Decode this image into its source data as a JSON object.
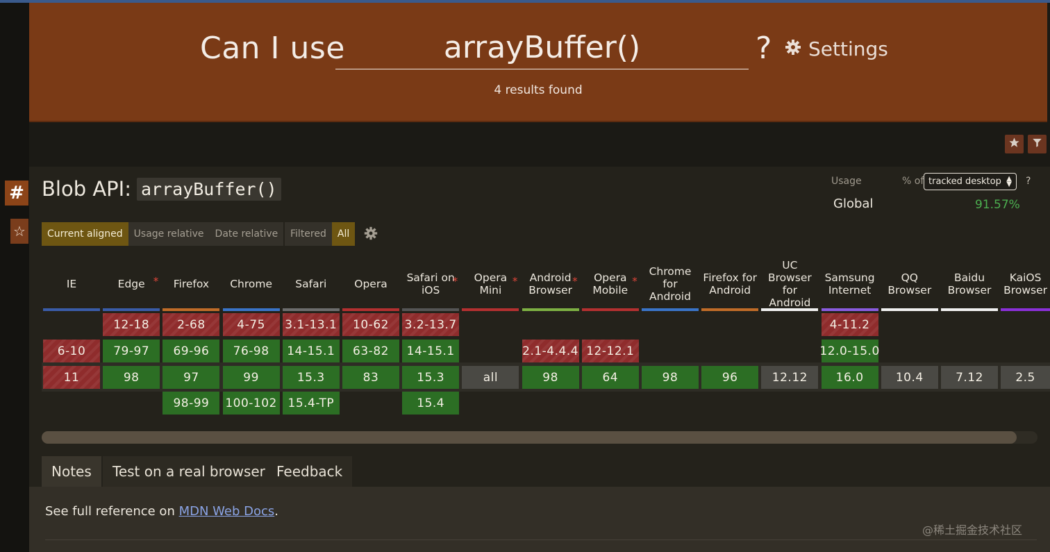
{
  "header": {
    "prefix": "Can I use",
    "search_value": "arrayBuffer()",
    "qmark": "?",
    "settings_label": "Settings",
    "results": "4 results found"
  },
  "feature": {
    "title": "Blob API:",
    "code": "arrayBuffer()",
    "usage_label": "Usage",
    "pct_of": "% of",
    "tracked": "tracked desktop",
    "help": "?",
    "global_label": "Global",
    "global_pct": "91.57%"
  },
  "view_modes": [
    "Current aligned",
    "Usage relative",
    "Date relative"
  ],
  "filters": [
    "Filtered",
    "All"
  ],
  "browsers": [
    {
      "name": "IE",
      "color": "#3a5ca8",
      "star": false
    },
    {
      "name": "Edge",
      "color": "#3a5ca8",
      "star": true
    },
    {
      "name": "Firefox",
      "color": "#c06c28",
      "star": false
    },
    {
      "name": "Chrome",
      "color": "#3a74c8",
      "star": false
    },
    {
      "name": "Safari",
      "color": "#6d6d6d",
      "star": false
    },
    {
      "name": "Opera",
      "color": "#b43030",
      "star": false
    },
    {
      "name": "Safari on iOS",
      "color": "#555555",
      "star": true
    },
    {
      "name": "Opera Mini",
      "color": "#b43030",
      "star": true
    },
    {
      "name": "Android Browser",
      "color": "#7db043",
      "star": true
    },
    {
      "name": "Opera Mobile",
      "color": "#b43030",
      "star": true
    },
    {
      "name": "Chrome for Android",
      "color": "#3a74c8",
      "star": false
    },
    {
      "name": "Firefox for Android",
      "color": "#c06c28",
      "star": false
    },
    {
      "name": "UC Browser for Android",
      "color": "#f0f0f0",
      "star": false
    },
    {
      "name": "Samsung Internet",
      "color": "#8a5ce0",
      "star": false
    },
    {
      "name": "QQ Browser",
      "color": "#f0f0f0",
      "star": false
    },
    {
      "name": "Baidu Browser",
      "color": "#f0f0f0",
      "star": false
    },
    {
      "name": "KaiOS Browser",
      "color": "#8a30d8",
      "star": false
    }
  ],
  "support": [
    [
      "",
      "12-18",
      "2-68",
      "4-75",
      "3.1-13.1",
      "10-62",
      "3.2-13.7",
      "",
      "",
      "",
      "",
      "",
      "",
      "4-11.2",
      "",
      "",
      ""
    ],
    [
      "6-10",
      "79-97",
      "69-96",
      "76-98",
      "14-15.1",
      "63-82",
      "14-15.1",
      "",
      "2.1-4.4.4",
      "12-12.1",
      "",
      "",
      "",
      "12.0-15.0",
      "",
      "",
      ""
    ],
    [
      "11",
      "98",
      "97",
      "99",
      "15.3",
      "83",
      "15.3",
      "all",
      "98",
      "64",
      "98",
      "96",
      "12.12",
      "16.0",
      "10.4",
      "7.12",
      "2.5"
    ],
    [
      "",
      "",
      "98-99",
      "100-102",
      "15.4-TP",
      "",
      "15.4",
      "",
      "",
      "",
      "",
      "",
      "",
      "",
      "",
      "",
      ""
    ]
  ],
  "status": [
    [
      "",
      "n",
      "n",
      "n",
      "n",
      "n",
      "n",
      "",
      "",
      "",
      "",
      "",
      "",
      "n",
      "",
      "",
      ""
    ],
    [
      "n",
      "y",
      "y",
      "y",
      "y",
      "y",
      "y",
      "",
      "n",
      "n",
      "",
      "",
      "",
      "y",
      "",
      "",
      ""
    ],
    [
      "n",
      "y",
      "y",
      "y",
      "y",
      "y",
      "y",
      "u",
      "y",
      "y",
      "y",
      "y",
      "u",
      "y",
      "u",
      "u",
      "u"
    ],
    [
      "",
      "",
      "y",
      "y",
      "y",
      "",
      "y",
      "",
      "",
      "",
      "",
      "",
      "",
      "",
      "",
      "",
      ""
    ]
  ],
  "bottom_tabs": [
    "Notes",
    "Test on a real browser",
    "Feedback"
  ],
  "notes": {
    "prefix": "See full reference on ",
    "link": "MDN Web Docs",
    "suffix": "."
  },
  "watermark": "@稀土掘金技术社区",
  "colors": {
    "header_bg": "#7a3a16",
    "supported": "#2c6e24",
    "unsupported": "#8f2c2c",
    "unknown": "#4a4944",
    "global_pct": "#4caf50"
  }
}
